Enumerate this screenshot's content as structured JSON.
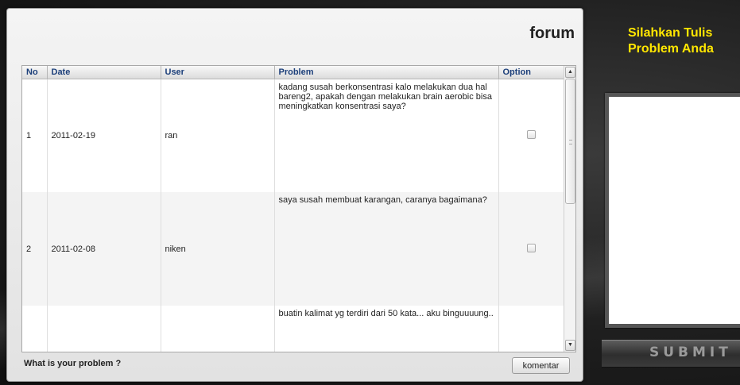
{
  "forum": {
    "title": "forum",
    "columns": [
      "No",
      "Date",
      "User",
      "Problem",
      "Option"
    ],
    "rows": [
      {
        "no": "1",
        "date": "2011-02-19",
        "user": "ran",
        "problem": "kadang susah berkonsentrasi kalo melakukan dua hal bareng2, apakah dengan melakukan brain aerobic bisa meningkatkan konsentrasi saya?"
      },
      {
        "no": "2",
        "date": "2011-02-08",
        "user": "niken",
        "problem": "saya susah membuat karangan, caranya bagaimana?"
      },
      {
        "no": "",
        "date": "",
        "user": "",
        "problem": "buatin kalimat yg terdiri dari 50 kata... aku binguuuung.."
      }
    ],
    "prompt": "What is your problem ?",
    "button_label": "komentar"
  },
  "side": {
    "heading": "Silahkan Tulis\nProblem Anda",
    "submit_label": "SUBMIT"
  },
  "colors": {
    "heading_yellow": "#ffe600",
    "header_text": "#1c3f7a"
  },
  "icons": {
    "scroll_up": "triangle-up",
    "scroll_down": "triangle-down"
  }
}
